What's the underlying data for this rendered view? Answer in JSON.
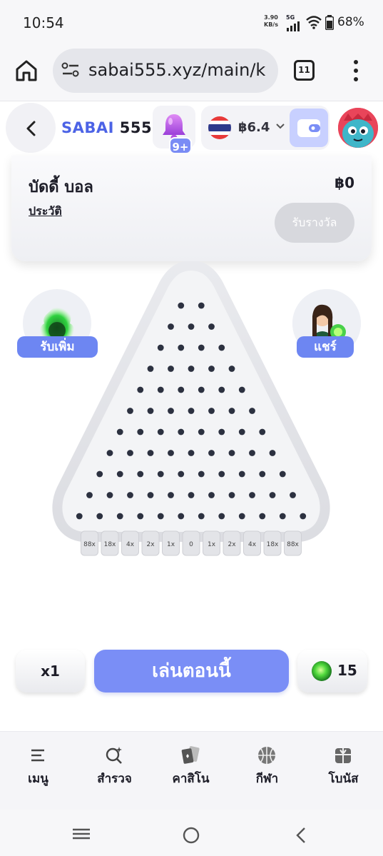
{
  "status_bar": {
    "time": "10:54",
    "net_speed": "3.90",
    "net_unit": "KB/s",
    "network_type": "5G",
    "battery": "68%"
  },
  "browser": {
    "url": "sabai555.xyz/main/k",
    "tab_count": "11"
  },
  "header": {
    "logo_part1": "SABAI",
    "logo_part2": "555",
    "notification_badge": "9+",
    "balance": "฿6.4"
  },
  "prize_card": {
    "title": "บัดดี้ บอล",
    "amount": "฿0",
    "history_link": "ประวัติ",
    "claim_button": "รับรางวัล"
  },
  "side_left": {
    "label": "รับเพิ่ม"
  },
  "side_right": {
    "label": "แชร์"
  },
  "board": {
    "peg_rows": 11,
    "slots": [
      "88x",
      "18x",
      "4x",
      "2x",
      "1x",
      "0",
      "1x",
      "2x",
      "4x",
      "18x",
      "88x"
    ]
  },
  "controls": {
    "multiplier": "x1",
    "play_button": "เล่นตอนนี้",
    "balls": "15"
  },
  "bottom_nav": [
    {
      "label": "เมนู",
      "icon": "menu-icon"
    },
    {
      "label": "สำรวจ",
      "icon": "explore-icon"
    },
    {
      "label": "คาสิโน",
      "icon": "cards-icon"
    },
    {
      "label": "กีฬา",
      "icon": "basketball-icon"
    },
    {
      "label": "โบนัส",
      "icon": "gift-icon"
    }
  ],
  "colors": {
    "accent": "#7a8ef6",
    "brand_blue": "#4c63e6",
    "peg": "#2c3140"
  }
}
